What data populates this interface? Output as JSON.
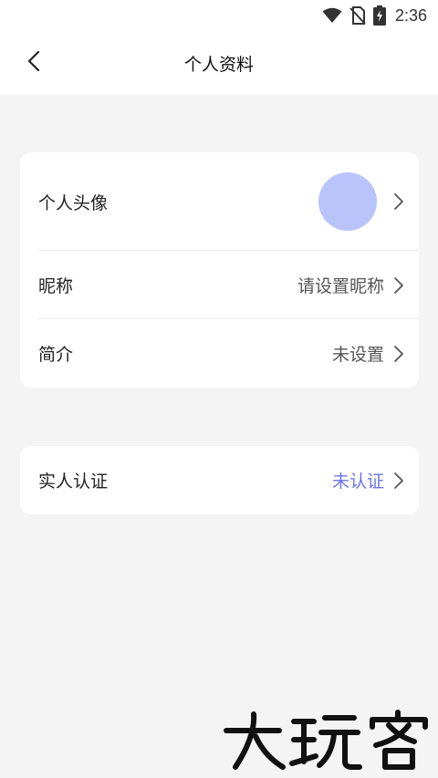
{
  "status_bar": {
    "time": "2:36",
    "icons": [
      "wifi-icon",
      "no-sim-icon",
      "battery-charging-icon"
    ]
  },
  "header": {
    "title": "个人资料",
    "back_icon": "chevron-left-icon"
  },
  "profile_card": {
    "avatar_row": {
      "label": "个人头像",
      "avatar_color": "#b9c4fb"
    },
    "nickname_row": {
      "label": "昵称",
      "value": "请设置昵称"
    },
    "bio_row": {
      "label": "简介",
      "value": "未设置"
    }
  },
  "verify_card": {
    "row": {
      "label": "实人认证",
      "value": "未认证",
      "value_color": "#6b74e0"
    }
  },
  "watermark": {
    "text": "大玩客"
  },
  "colors": {
    "background": "#f4f4f4",
    "card": "#ffffff",
    "accent": "#6b74e0"
  }
}
